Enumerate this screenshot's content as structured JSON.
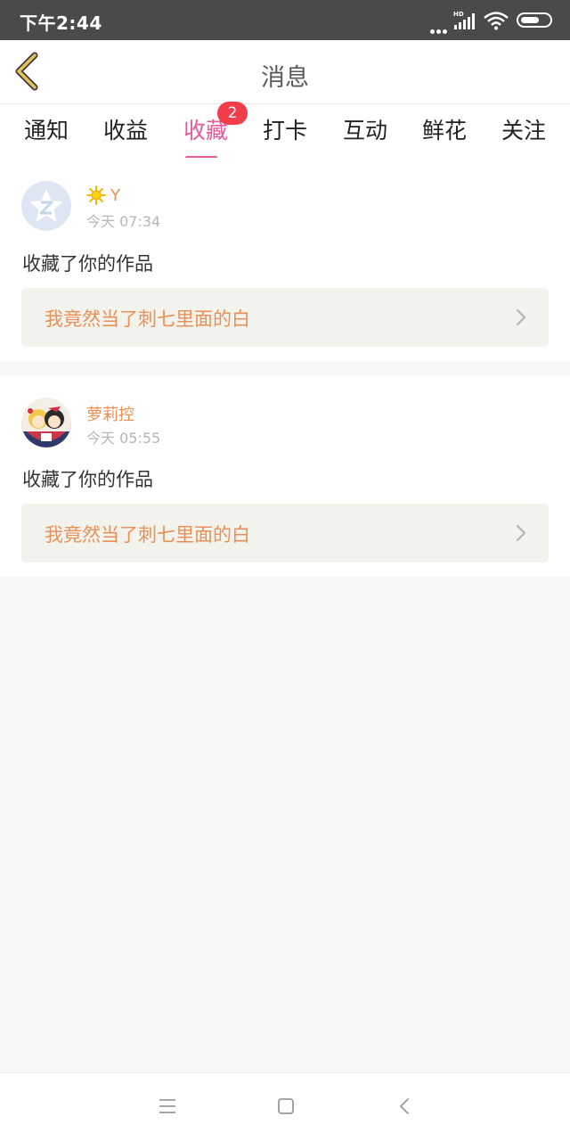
{
  "status_bar": {
    "time": "下午2:44",
    "icons": [
      "more-dots-icon",
      "hd-signal-icon",
      "wifi-icon",
      "battery-icon"
    ]
  },
  "header": {
    "title": "消息",
    "back_icon": "chevron-left-icon"
  },
  "tabs": [
    {
      "label": "通知"
    },
    {
      "label": "收益"
    },
    {
      "label": "收藏",
      "active": true,
      "badge": "2"
    },
    {
      "label": "打卡"
    },
    {
      "label": "互动"
    },
    {
      "label": "鲜花"
    },
    {
      "label": "关注"
    }
  ],
  "messages": [
    {
      "user": "Y",
      "user_icon": "sun-icon",
      "time": "今天 07:34",
      "action": "收藏了你的作品",
      "work_title": "我竟然当了刺七里面的白"
    },
    {
      "user": "萝莉控",
      "time": "今天 05:55",
      "action": "收藏了你的作品",
      "work_title": "我竟然当了刺七里面的白"
    }
  ],
  "colors": {
    "accent": "#e55a9c",
    "username": "#ea9056",
    "badge": "#f23d4a",
    "status_bar": "#4a4a4a",
    "back_icon": "#d8b64a"
  },
  "nav": {
    "icons": [
      "menu-icon",
      "home-square-icon",
      "back-triangle-icon"
    ]
  }
}
